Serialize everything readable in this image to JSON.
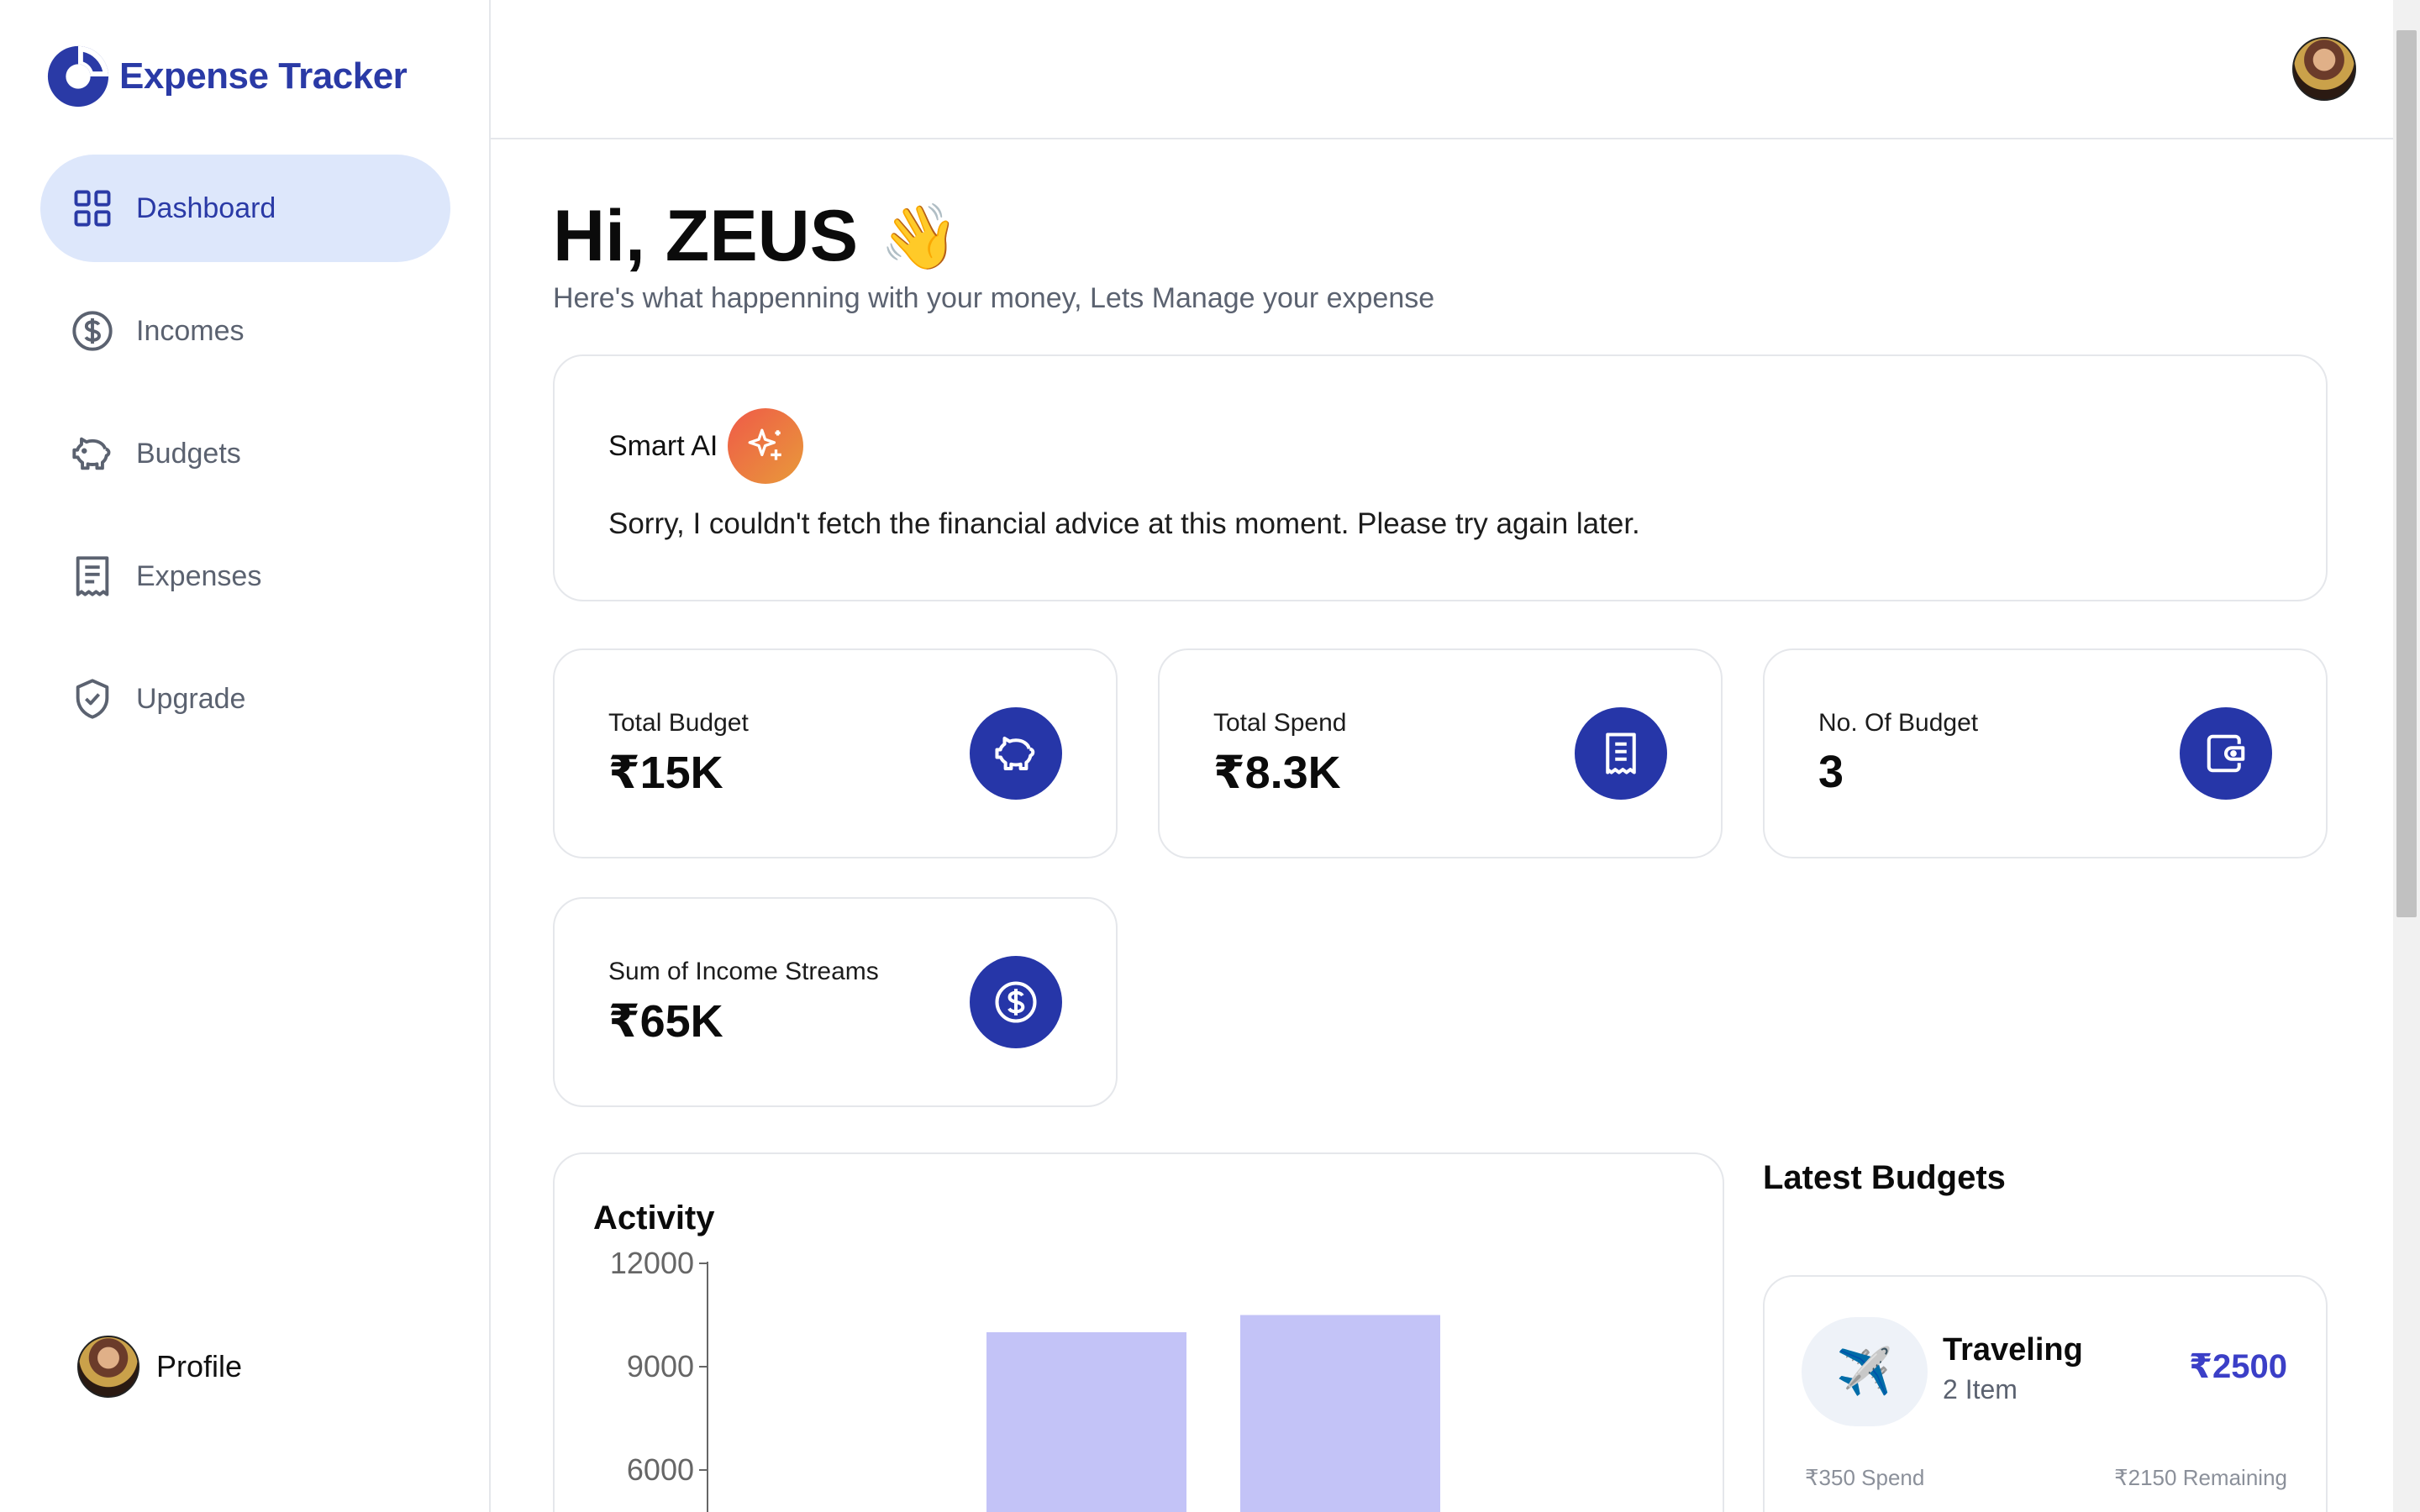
{
  "app": {
    "name": "Expense Tracker"
  },
  "sidebar": {
    "items": [
      {
        "label": "Dashboard",
        "icon": "grid-icon",
        "active": true
      },
      {
        "label": "Incomes",
        "icon": "dollar-circle-icon",
        "active": false
      },
      {
        "label": "Budgets",
        "icon": "piggy-bank-icon",
        "active": false
      },
      {
        "label": "Expenses",
        "icon": "receipt-icon",
        "active": false
      },
      {
        "label": "Upgrade",
        "icon": "shield-check-icon",
        "active": false
      }
    ],
    "profile_label": "Profile"
  },
  "greeting": {
    "title": "Hi, ZEUS",
    "emoji": "👋",
    "subtitle": "Here's what happenning with your money, Lets Manage your expense"
  },
  "smart_ai": {
    "title": "Smart AI",
    "message": "Sorry, I couldn't fetch the financial advice at this moment. Please try again later."
  },
  "stats": [
    {
      "label": "Total Budget",
      "value": "₹15K",
      "icon": "piggy-bank-icon"
    },
    {
      "label": "Total Spend",
      "value": "₹8.3K",
      "icon": "receipt-icon"
    },
    {
      "label": "No. Of Budget",
      "value": "3",
      "icon": "wallet-icon"
    },
    {
      "label": "Sum of Income Streams",
      "value": "₹65K",
      "icon": "dollar-circle-icon"
    }
  ],
  "activity": {
    "title": "Activity",
    "chart_data": {
      "type": "bar",
      "title": "Activity",
      "yticks": [
        12000,
        9000,
        6000
      ],
      "series": [
        {
          "values": [
            10000
          ]
        },
        {
          "values": [
            10500
          ]
        }
      ],
      "bar_color": "#c3c3f7"
    }
  },
  "latest_budgets": {
    "title": "Latest Budgets",
    "items": [
      {
        "icon": "✈️",
        "name": "Traveling",
        "items": "2 Item",
        "amount": "₹2500",
        "spend": "₹350 Spend",
        "remaining": "₹2150 Remaining"
      }
    ]
  },
  "colors": {
    "brand": "#2a3aa6",
    "accent": "#2636a8",
    "active_bg": "#dde7fb",
    "amount": "#3b3fc7"
  }
}
